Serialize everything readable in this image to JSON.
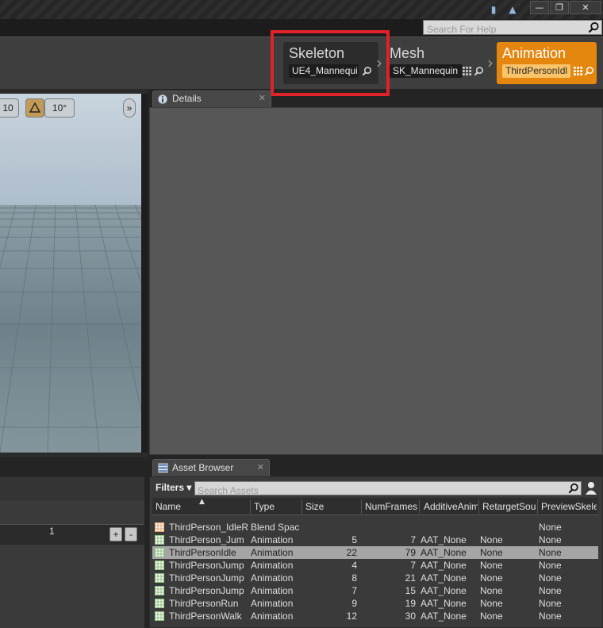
{
  "help_search": {
    "placeholder": "Search For Help"
  },
  "modes": {
    "skeleton": {
      "title": "Skeleton",
      "asset": "UE4_Mannequi"
    },
    "mesh": {
      "title": "Mesh",
      "asset": "SK_Mannequin"
    },
    "animation": {
      "title": "Animation",
      "asset": "ThirdPersonIdl"
    }
  },
  "viewport": {
    "grid_size": "10",
    "rotation_snap": "10°"
  },
  "details": {
    "tab_label": "Details"
  },
  "bottom_left": {
    "value": "1",
    "add": "+",
    "remove": "-"
  },
  "asset_browser": {
    "tab_label": "Asset Browser",
    "filters_label": "Filters",
    "search_placeholder": "Search Assets",
    "columns": [
      "Name",
      "Type",
      "Size",
      "NumFrames",
      "AdditiveAnim",
      "RetargetSou",
      "PreviewSkele"
    ],
    "rows": [
      {
        "name": "ThirdPerson_IdleR",
        "type": "Blend Spac",
        "size": "",
        "frames": "",
        "additive": "",
        "retarget": "",
        "preview": "None",
        "selected": false,
        "kind": "blendspace"
      },
      {
        "name": "ThirdPerson_Jum",
        "type": "Animation",
        "size": "5",
        "frames": "7",
        "additive": "AAT_None",
        "retarget": "None",
        "preview": "None",
        "selected": false,
        "kind": "anim"
      },
      {
        "name": "ThirdPersonIdle",
        "type": "Animation",
        "size": "22",
        "frames": "79",
        "additive": "AAT_None",
        "retarget": "None",
        "preview": "None",
        "selected": true,
        "kind": "anim"
      },
      {
        "name": "ThirdPersonJump",
        "type": "Animation",
        "size": "4",
        "frames": "7",
        "additive": "AAT_None",
        "retarget": "None",
        "preview": "None",
        "selected": false,
        "kind": "anim"
      },
      {
        "name": "ThirdPersonJump",
        "type": "Animation",
        "size": "8",
        "frames": "21",
        "additive": "AAT_None",
        "retarget": "None",
        "preview": "None",
        "selected": false,
        "kind": "anim"
      },
      {
        "name": "ThirdPersonJump",
        "type": "Animation",
        "size": "7",
        "frames": "15",
        "additive": "AAT_None",
        "retarget": "None",
        "preview": "None",
        "selected": false,
        "kind": "anim"
      },
      {
        "name": "ThirdPersonRun",
        "type": "Animation",
        "size": "9",
        "frames": "19",
        "additive": "AAT_None",
        "retarget": "None",
        "preview": "None",
        "selected": false,
        "kind": "anim"
      },
      {
        "name": "ThirdPersonWalk",
        "type": "Animation",
        "size": "12",
        "frames": "30",
        "additive": "AAT_None",
        "retarget": "None",
        "preview": "None",
        "selected": false,
        "kind": "anim"
      }
    ]
  },
  "colors": {
    "accent": "#e5860f",
    "highlight_box": "#e0212a"
  }
}
